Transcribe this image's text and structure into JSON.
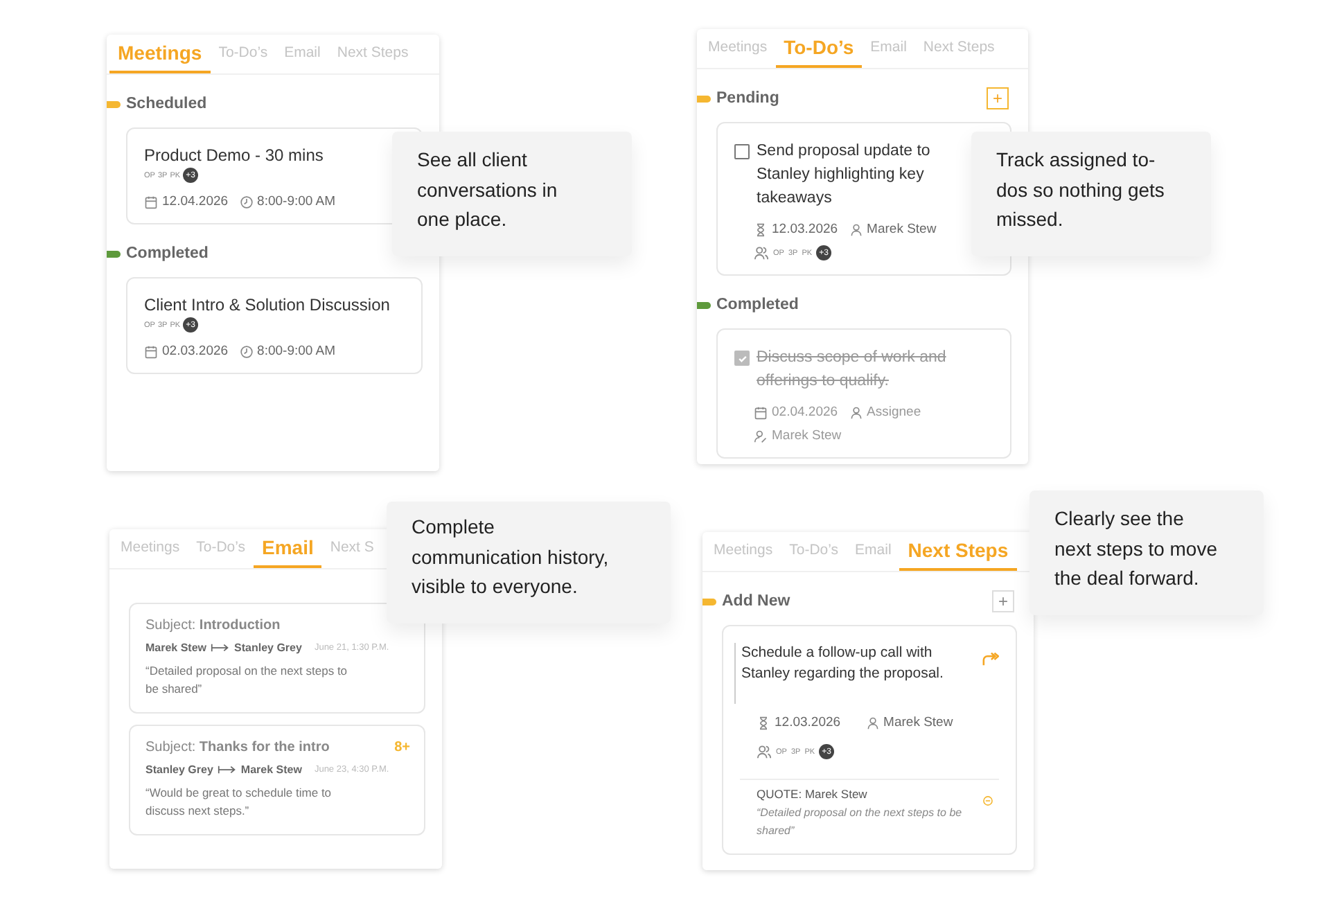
{
  "panels": [
    {
      "kind": "meetings",
      "callout": "See all client conversations in one place.",
      "tabs": [
        {
          "label": "Meetings",
          "selected": true
        },
        {
          "label": "To-Do’s",
          "selected": false
        },
        {
          "label": "Email",
          "selected": false
        },
        {
          "label": "Next Steps",
          "selected": false
        }
      ],
      "sections": [
        {
          "title": "Scheduled",
          "color": "#f5b731",
          "cards": [
            {
              "title": "Product Demo - 30 mins",
              "avatars": [
                "OP",
                "3P",
                "PK"
              ],
              "more": "+3",
              "meta": [
                {
                  "kind": "date",
                  "text": "12.04.2026"
                },
                {
                  "kind": "time",
                  "text": "8:00-9:00 AM"
                }
              ]
            }
          ]
        },
        {
          "title": "Completed",
          "color": "#5e9a3c",
          "cards": [
            {
              "title": "Client Intro & Solution Discussion",
              "avatars": [
                "OP",
                "3P",
                "PK"
              ],
              "more": "+3",
              "meta": [
                {
                  "kind": "date",
                  "text": "02.03.2026"
                },
                {
                  "kind": "time",
                  "text": "8:00-9:00 AM"
                }
              ]
            }
          ]
        }
      ]
    },
    {
      "kind": "todos",
      "callout": "Track assigned to-dos so nothing gets missed.",
      "tabs": [
        {
          "label": "Meetings",
          "selected": false
        },
        {
          "label": "To-Do’s",
          "selected": true
        },
        {
          "label": "Email",
          "selected": false
        },
        {
          "label": "Next Steps",
          "selected": false
        }
      ],
      "sections": [
        {
          "title": "Pending",
          "color": "#f5b731",
          "add_button": {
            "label": "+",
            "highlighted": true
          },
          "cards": [
            {
              "text": "Send proposal update to Stanley highlighting key takeaways",
              "checked": false,
              "meta": [
                {
                  "kind": "deadline",
                  "text": "12.03.2026"
                },
                {
                  "kind": "person",
                  "text": "Marek Stew"
                },
                {
                  "kind": "people",
                  "avatars": [
                    "OP",
                    "3P",
                    "PK"
                  ],
                  "more": "+3"
                }
              ]
            }
          ]
        },
        {
          "title": "Completed",
          "color": "#5e9a3c",
          "cards": [
            {
              "text": "Discuss scope of work and offerings to qualify.",
              "checked": true,
              "meta": [
                {
                  "kind": "date",
                  "text": "02.04.2026"
                },
                {
                  "kind": "person",
                  "text": "Assignee"
                },
                {
                  "kind": "owner",
                  "text": "Marek Stew"
                }
              ]
            }
          ]
        }
      ]
    },
    {
      "kind": "emails",
      "callout": "Complete communication history, visible to everyone.",
      "tabs": [
        {
          "label": "Meetings",
          "selected": false
        },
        {
          "label": "To-Do’s",
          "selected": false
        },
        {
          "label": "Email",
          "selected": true
        },
        {
          "label": "Next S",
          "selected": false
        }
      ],
      "emails": [
        {
          "subject": "Subject: **Introduction**",
          "from": "Marek Stew",
          "to": "Stanley Grey",
          "time": "June 21, 1:30 P.M.",
          "snippet": "“Detailed proposal on the next steps to be shared”"
        },
        {
          "subject": "Subject: **Thanks for the intro**",
          "count": "8+",
          "from": "Stanley Grey",
          "to": "Marek Stew",
          "time": "June 23, 4:30 P.M.",
          "snippet": "“Would be great to schedule time to discuss next steps.”"
        }
      ]
    },
    {
      "kind": "nextsteps",
      "callout": "Clearly see the next steps to move the deal forward.",
      "tabs": [
        {
          "label": "Meetings",
          "selected": false
        },
        {
          "label": "To-Do’s",
          "selected": false
        },
        {
          "label": "Email",
          "selected": false
        },
        {
          "label": "Next Steps",
          "selected": true
        }
      ],
      "sections": [
        {
          "title": "Add New",
          "color": "#f5b731",
          "add_button": {
            "label": "+",
            "highlighted": false
          },
          "cards": [
            {
              "text": "Schedule a follow-up call with Stanley regarding the proposal.",
              "meta": [
                {
                  "kind": "deadline",
                  "text": "12.03.2026"
                },
                {
                  "kind": "person",
                  "text": "Marek Stew"
                },
                {
                  "kind": "people",
                  "avatars": [
                    "OP",
                    "3P",
                    "PK"
                  ],
                  "more": "+3"
                }
              ],
              "quote_author": "QUOTE: Marek Stew",
              "quote": "“Detailed proposal on the next steps to be shared”"
            }
          ]
        }
      ]
    }
  ]
}
